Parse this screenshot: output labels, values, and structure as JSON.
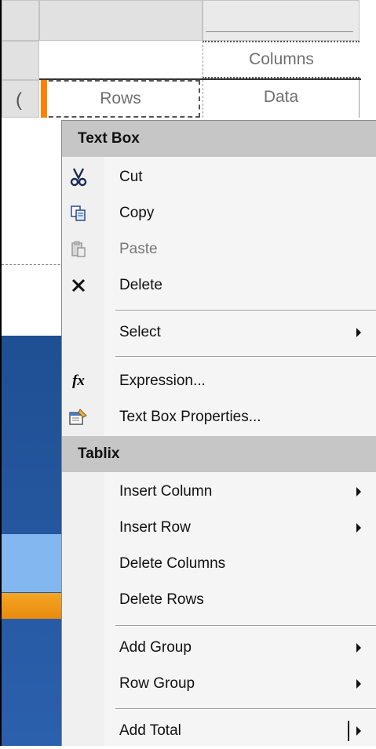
{
  "designer": {
    "columns_label": "Columns",
    "rows_label": "Rows",
    "data_label": "Data"
  },
  "menu": {
    "text_box_header": "Text Box",
    "cut": "Cut",
    "copy": "Copy",
    "paste": "Paste",
    "delete": "Delete",
    "select": "Select",
    "expression": "Expression...",
    "text_box_properties": "Text Box Properties...",
    "tablix_header": "Tablix",
    "insert_column": "Insert Column",
    "insert_row": "Insert Row",
    "delete_columns": "Delete Columns",
    "delete_rows": "Delete Rows",
    "add_group": "Add Group",
    "row_group": "Row Group",
    "add_total": "Add Total"
  },
  "icons": {
    "cut": "scissors-icon",
    "copy": "copy-icon",
    "paste": "paste-icon",
    "delete": "delete-x-icon",
    "expression": "fx-icon",
    "properties": "properties-icon"
  },
  "colors": {
    "header_bg": "#c6c6c6",
    "menu_bg": "#f5f5f5",
    "selection_handle": "#ff7f00",
    "panel_blue": "#1f4f93"
  }
}
